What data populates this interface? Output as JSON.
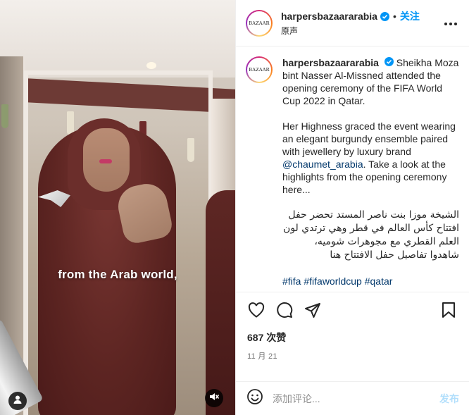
{
  "video": {
    "caption": "from the Arab world,",
    "icons": {
      "user": "user-tag-icon",
      "mute": "speaker-muted-icon"
    }
  },
  "post": {
    "username": "harpersbazaararabia",
    "avatar_text": "BAZAAR",
    "follow_label": "关注",
    "separator": "•",
    "audio_label": "原声",
    "caption": {
      "username": "harpersbazaararabia",
      "line1": "Sheikha Moza bint Nasser Al-Missned attended the opening ceremony of the FIFA World Cup 2022 in Qatar.",
      "line2_before": "Her Highness graced the event wearing an elegant burgundy ensemble paired with jewellery by luxury brand ",
      "mention": "@chaumet_arabia",
      "line2_after": ". Take a look at the highlights from the opening ceremony here...",
      "arabic": "الشيخة موزا بنت ناصر المستد تحضر حفل افتتاح كأس العالم في قطر وهي ترتدي لون العلم القطري مع مجوهرات شوميه، شاهدوا تفاصيل حفل الافتتاح هنا",
      "hashtags": "#fifa #fifaworldcup #qatar"
    },
    "likes": "687 次赞",
    "date": "11 月 21",
    "comment_placeholder": "添加评论...",
    "post_label": "发布"
  },
  "colors": {
    "accent": "#0095f6",
    "link": "#00376b",
    "post_disabled": "#b2dffc",
    "caption_text": "#262626",
    "muted": "#737373"
  }
}
